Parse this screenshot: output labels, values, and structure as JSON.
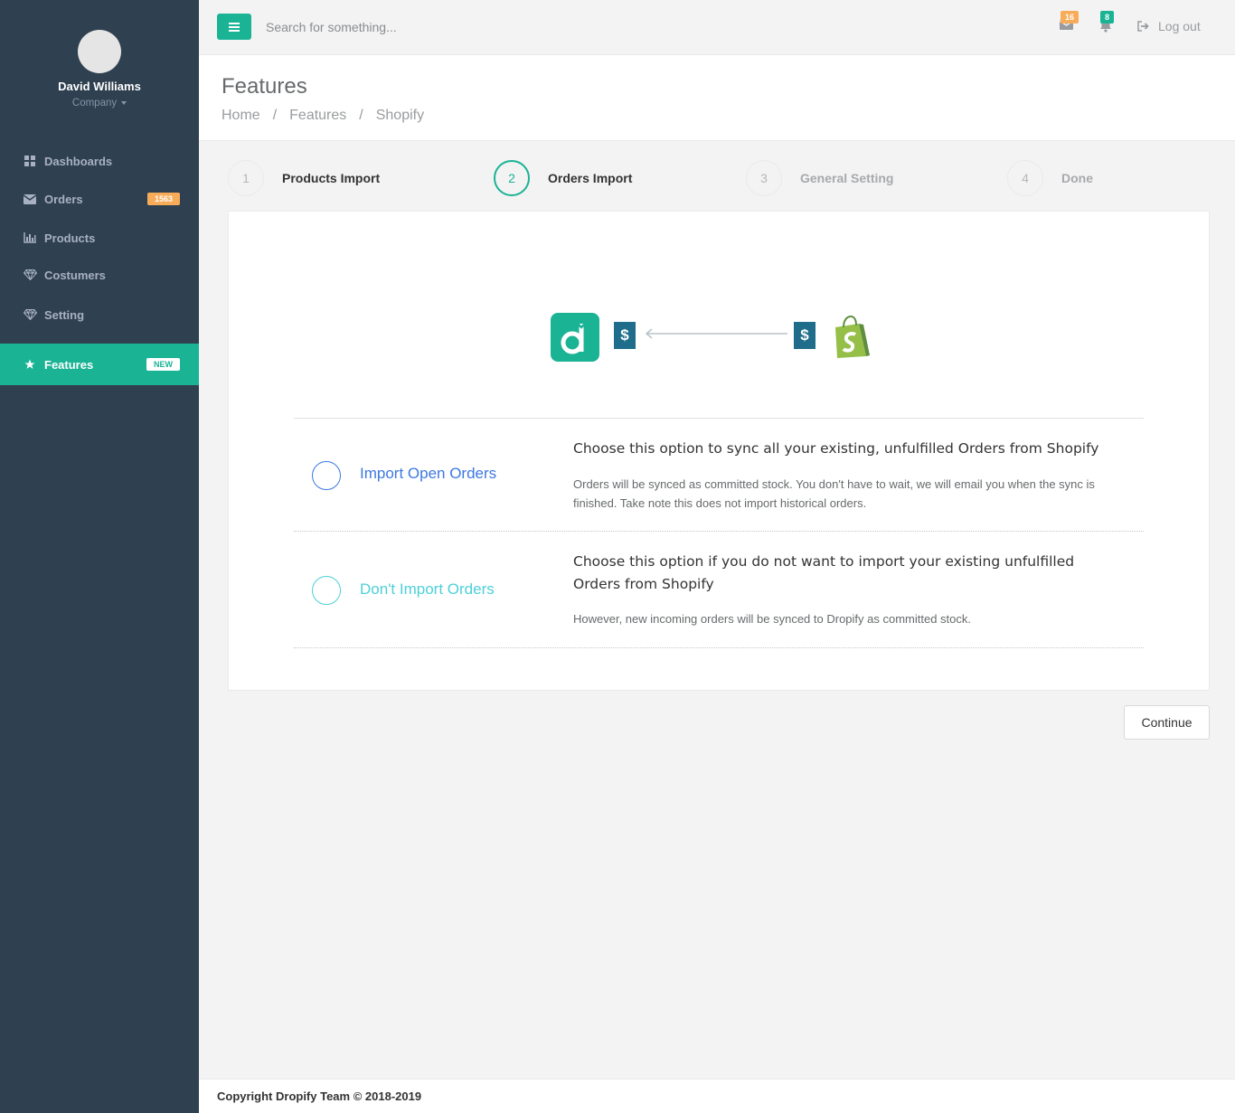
{
  "sidebar": {
    "profile": {
      "name": "David Williams",
      "role": "Company"
    },
    "items": [
      {
        "label": "Dashboards",
        "icon": "grid-icon"
      },
      {
        "label": "Orders",
        "icon": "envelope-icon",
        "badge": "1563"
      },
      {
        "label": "Products",
        "icon": "bar-chart-icon"
      },
      {
        "label": "Costumers",
        "icon": "diamond-icon"
      },
      {
        "label": "Setting",
        "icon": "diamond-icon"
      },
      {
        "label": "Features",
        "icon": "star-icon",
        "badge": "NEW",
        "active": true
      }
    ]
  },
  "topbar": {
    "search_placeholder": "Search for something...",
    "messages_count": "16",
    "notifications_count": "8",
    "logout_label": "Log out"
  },
  "heading": {
    "title": "Features",
    "breadcrumb": [
      "Home",
      "Features",
      "Shopify"
    ]
  },
  "wizard": {
    "steps": [
      {
        "number": "1",
        "label": "Products Import",
        "state": "done"
      },
      {
        "number": "2",
        "label": "Orders Import",
        "state": "active"
      },
      {
        "number": "3",
        "label": "General Setting",
        "state": "pending"
      },
      {
        "number": "4",
        "label": "Done",
        "state": "pending"
      }
    ]
  },
  "hero": {
    "dollar_symbol": "$"
  },
  "options": [
    {
      "label": "Import Open Orders",
      "title": "Choose this option to sync all your existing, unfulfilled Orders from Shopify",
      "description": "Orders will be synced as committed stock. You don't have to wait, we will email you when the sync is finished. Take note this does not import historical orders."
    },
    {
      "label": "Don't Import Orders",
      "title": "Choose this option if you do not want to import your existing unfulfilled Orders from Shopify",
      "description": "However, new incoming orders will be synced to Dropify as committed stock."
    }
  ],
  "continue_label": "Continue",
  "footer": {
    "copyright": "Copyright Dropify Team © 2018-2019"
  },
  "colors": {
    "primary": "#1ab394",
    "sidebar": "#2f4050",
    "badge_orange": "#f8ac59",
    "option_blue": "#3c78e0",
    "option_teal": "#4dd0d8"
  }
}
